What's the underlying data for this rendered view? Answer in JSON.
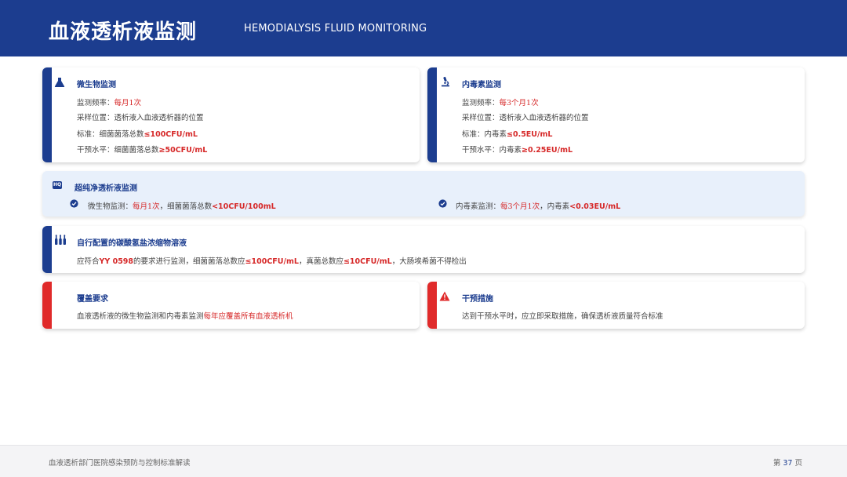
{
  "header": {
    "title": "血液透析液监测",
    "subtitle": "HEMODIALYSIS FLUID MONITORING"
  },
  "micro": {
    "title": "微生物监测",
    "freq_label": "监测频率：",
    "freq_value": "每月1次",
    "site": "采样位置：透析液入血液透析器的位置",
    "std_label": "标准：细菌菌落总数",
    "std_value": "≤100CFU/mL",
    "int_label": "干预水平：细菌菌落总数",
    "int_value": "≥50CFU/mL"
  },
  "endo": {
    "title": "内毒素监测",
    "freq_label": "监测频率：",
    "freq_value": "每3个月1次",
    "site": "采样位置：透析液入血液透析器的位置",
    "std_label": "标准：内毒素",
    "std_value": "≤0.5EU/mL",
    "int_label": "干预水平：内毒素",
    "int_value": "≥0.25EU/mL"
  },
  "ultra": {
    "badge": "HQ",
    "title": "超纯净透析液监测",
    "left_label": "微生物监测：",
    "left_freq": "每月1次",
    "left_mid": "，细菌菌落总数",
    "left_value": "<10CFU/100mL",
    "right_label": "内毒素监测：",
    "right_freq": "每3个月1次",
    "right_mid": "，内毒素",
    "right_value": "<0.03EU/mL"
  },
  "bicarb": {
    "title": "自行配置的碳酸氢盐浓缩物溶液",
    "t1": "应符合",
    "std": "YY 0598",
    "t2": "的要求进行监测，细菌菌落总数应",
    "v1": "≤100CFU/mL",
    "t3": "，真菌总数应",
    "v2": "≤10CFU/mL",
    "t4": "，大肠埃希菌不得检出"
  },
  "coverage": {
    "title": "覆盖要求",
    "t1": "血液透析液的微生物监测和内毒素监测",
    "hl": "每年应覆盖所有血液透析机"
  },
  "intervention": {
    "title": "干预措施",
    "text": "达到干预水平时，应立即采取措施，确保透析液质量符合标准"
  },
  "footer": {
    "left": "血液透析部门医院感染预防与控制标准解读",
    "page_prefix": "第",
    "page_num": "37",
    "page_suffix": "页"
  },
  "colors": {
    "primary": "#1c3d8f",
    "accent_red": "#e02a2a",
    "highlight": "#d62828",
    "ultra_bg": "#e8f0fb"
  }
}
